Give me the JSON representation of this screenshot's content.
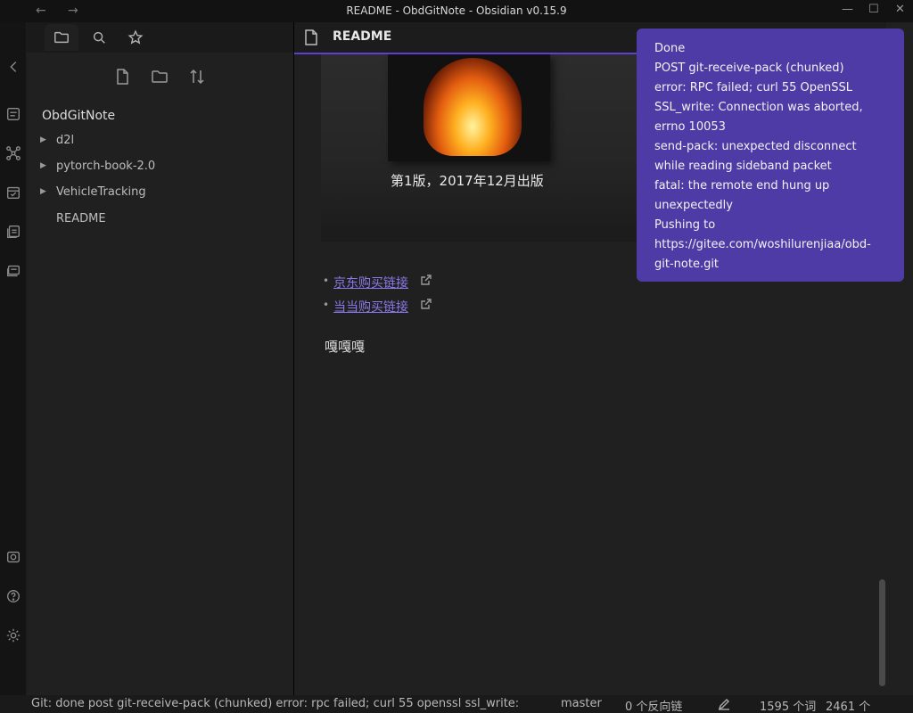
{
  "window": {
    "title": "README - ObdGitNote - Obsidian v0.15.9",
    "back_icon": "arrow-left-icon",
    "forward_icon": "arrow-right-icon"
  },
  "sidebar": {
    "vault_name": "ObdGitNote",
    "tree": [
      {
        "label": "d2l",
        "folder": true
      },
      {
        "label": "pytorch-book-2.0",
        "folder": true
      },
      {
        "label": "VehicleTracking",
        "folder": true
      },
      {
        "label": "README",
        "folder": false
      }
    ]
  },
  "editor": {
    "tab_title": "README",
    "caption": "第1版，2017年12月出版",
    "links": [
      {
        "text": "京东购买链接"
      },
      {
        "text": "当当购买链接"
      }
    ],
    "paragraph": "嘎嘎嘎"
  },
  "notice": {
    "text": "Done\nPOST git-receive-pack (chunked)\nerror: RPC failed; curl 55 OpenSSL SSL_write: Connection was aborted, errno 10053\nsend-pack: unexpected disconnect while reading sideband packet\nfatal: the remote end hung up unexpectedly\nPushing to https://gitee.com/woshilurenjiaa/obd-git-note.git"
  },
  "statusbar": {
    "git_message": "Git: done post git-receive-pack (chunked) error: rpc failed; curl 55 openssl ssl_write:",
    "branch": "master",
    "backlinks": "0 个反向链",
    "word_count": "1595 个词",
    "char_count": "2461 个"
  },
  "colors": {
    "accent": "#5d3fd3",
    "notice_bg": "#4e3ba6",
    "link": "#8a79e8"
  }
}
